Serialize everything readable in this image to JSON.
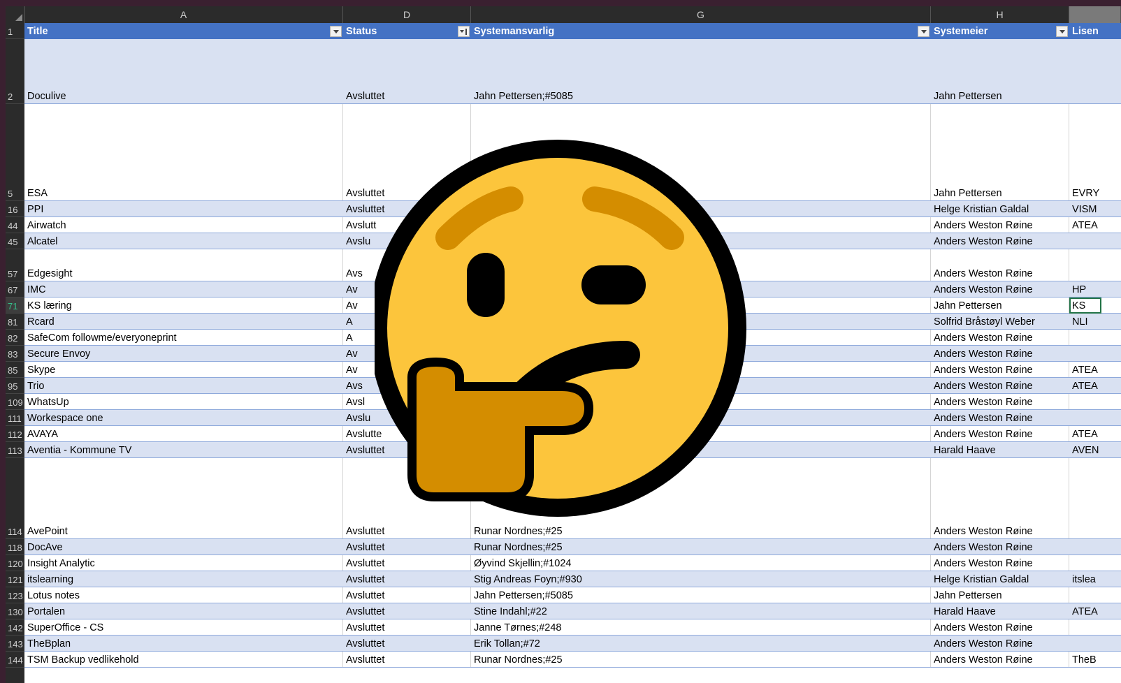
{
  "columns": {
    "A": "A",
    "D": "D",
    "G": "G",
    "H": "H"
  },
  "header": {
    "row": "1",
    "title": "Title",
    "status": "Status",
    "systemansvarlig": "Systemansvarlig",
    "systemeier": "Systemeier",
    "lisens": "Lisen"
  },
  "rows": [
    {
      "num": "2",
      "title": "Doculive",
      "status": "Avsluttet",
      "ansvarlig": "Jahn Pettersen;#5085",
      "eier": "Jahn Pettersen",
      "lisens": ""
    },
    {
      "num": "5",
      "title": "ESA",
      "status": "Avsluttet",
      "ansvarlig": "",
      "eier": "Jahn Pettersen",
      "lisens": "EVRY"
    },
    {
      "num": "16",
      "title": "PPI",
      "status": "Avsluttet",
      "ansvarlig": "",
      "eier": "Helge Kristian Galdal",
      "lisens": "VISM"
    },
    {
      "num": "44",
      "title": "Airwatch",
      "status": "Avslutt",
      "ansvarlig": "",
      "eier": "Anders Weston Røine",
      "lisens": "ATEA"
    },
    {
      "num": "45",
      "title": "Alcatel",
      "status": "Avslu",
      "ansvarlig": "",
      "eier": "Anders Weston Røine",
      "lisens": ""
    },
    {
      "num": "57",
      "title": "Edgesight",
      "status": "Avs",
      "ansvarlig": "",
      "eier": "Anders Weston Røine",
      "lisens": ""
    },
    {
      "num": "67",
      "title": "IMC",
      "status": "Av",
      "ansvarlig": "",
      "eier": "Anders Weston Røine",
      "lisens": "HP"
    },
    {
      "num": "71",
      "title": "KS læring",
      "status": "Av",
      "ansvarlig": "",
      "eier": "Jahn Pettersen",
      "lisens": "KS"
    },
    {
      "num": "81",
      "title": "Rcard",
      "status": "A",
      "ansvarlig": "",
      "eier": "Solfrid Bråstøyl Weber",
      "lisens": "NLI"
    },
    {
      "num": "82",
      "title": "SafeCom followme/everyoneprint",
      "status": "A",
      "ansvarlig": "",
      "eier": "Anders Weston Røine",
      "lisens": ""
    },
    {
      "num": "83",
      "title": "Secure Envoy",
      "status": "Av",
      "ansvarlig": "",
      "eier": "Anders Weston Røine",
      "lisens": ""
    },
    {
      "num": "85",
      "title": "Skype",
      "status": "Av",
      "ansvarlig": "",
      "eier": "Anders Weston Røine",
      "lisens": "ATEA"
    },
    {
      "num": "95",
      "title": "Trio",
      "status": "Avs",
      "ansvarlig": "",
      "eier": "Anders Weston Røine",
      "lisens": "ATEA"
    },
    {
      "num": "109",
      "title": "WhatsUp",
      "status": "Avsl",
      "ansvarlig": "",
      "eier": "Anders Weston Røine",
      "lisens": ""
    },
    {
      "num": "111",
      "title": "Workespace one",
      "status": "Avslu",
      "ansvarlig": "",
      "eier": "Anders Weston Røine",
      "lisens": ""
    },
    {
      "num": "112",
      "title": "AVAYA",
      "status": "Avslutte",
      "ansvarlig": "",
      "eier": "Anders Weston Røine",
      "lisens": "ATEA"
    },
    {
      "num": "113",
      "title": "Aventia - Kommune TV",
      "status": "Avsluttet",
      "ansvarlig": "",
      "eier": "Harald Haave",
      "lisens": "AVEN"
    },
    {
      "num": "114",
      "title": "AvePoint",
      "status": "Avsluttet",
      "ansvarlig": "Runar Nordnes;#25",
      "eier": "Anders Weston Røine",
      "lisens": ""
    },
    {
      "num": "118",
      "title": "DocAve",
      "status": "Avsluttet",
      "ansvarlig": "Runar Nordnes;#25",
      "eier": "Anders Weston Røine",
      "lisens": ""
    },
    {
      "num": "120",
      "title": "Insight Analytic",
      "status": "Avsluttet",
      "ansvarlig": "Øyvind Skjellin;#1024",
      "eier": "Anders Weston Røine",
      "lisens": ""
    },
    {
      "num": "121",
      "title": "itslearning",
      "status": "Avsluttet",
      "ansvarlig": "Stig Andreas Foyn;#930",
      "eier": "Helge Kristian Galdal",
      "lisens": "itslea"
    },
    {
      "num": "123",
      "title": "Lotus notes",
      "status": "Avsluttet",
      "ansvarlig": "Jahn Pettersen;#5085",
      "eier": "Jahn Pettersen",
      "lisens": ""
    },
    {
      "num": "130",
      "title": "Portalen",
      "status": "Avsluttet",
      "ansvarlig": "Stine Indahl;#22",
      "eier": "Harald Haave",
      "lisens": "ATEA"
    },
    {
      "num": "142",
      "title": "SuperOffice - CS",
      "status": "Avsluttet",
      "ansvarlig": "Janne Tørnes;#248",
      "eier": "Anders Weston Røine",
      "lisens": ""
    },
    {
      "num": "143",
      "title": "TheBplan",
      "status": "Avsluttet",
      "ansvarlig": "Erik Tollan;#72",
      "eier": "Anders Weston Røine",
      "lisens": ""
    },
    {
      "num": "144",
      "title": "TSM Backup vedlikehold",
      "status": "Avsluttet",
      "ansvarlig": "Runar Nordnes;#25",
      "eier": "Anders Weston Røine",
      "lisens": "TheB"
    }
  ],
  "overlay": {
    "icon": "thinking-face-emoji-icon"
  },
  "colors": {
    "header_blue": "#4472c4",
    "band": "#d9e1f2",
    "emoji_face": "#fcc53c",
    "emoji_hand": "#d48d00"
  }
}
